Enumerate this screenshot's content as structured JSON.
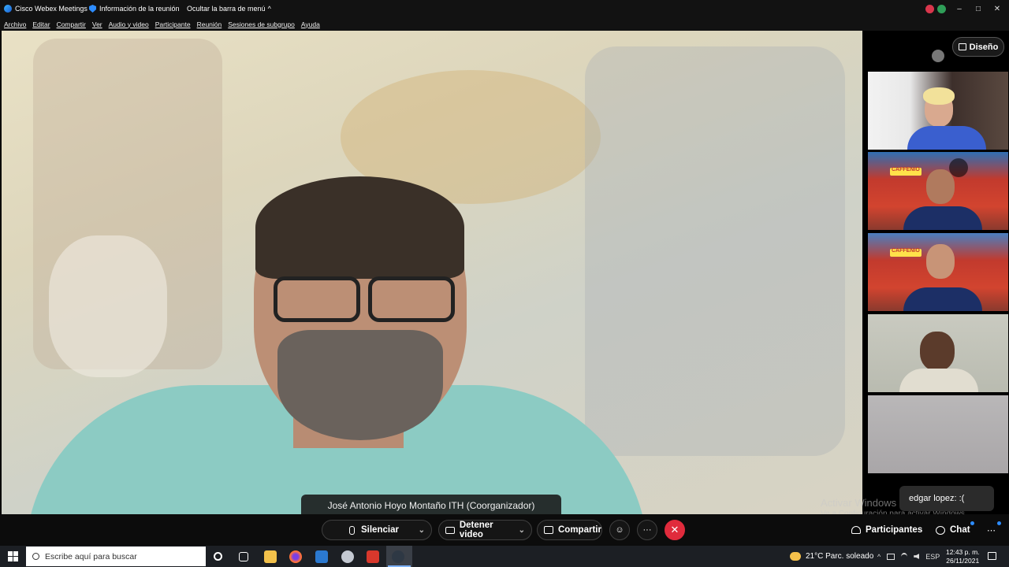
{
  "titlebar": {
    "app_name": "Cisco Webex Meetings",
    "meeting_info": "Información de la reunión",
    "hide_menu": "Ocultar la barra de menú",
    "hide_chevron": "^",
    "minimize": "–",
    "maximize": "□",
    "close": "✕"
  },
  "menu": {
    "items": [
      "Archivo",
      "Editar",
      "Compartir",
      "Ver",
      "Audio y video",
      "Participante",
      "Reunión",
      "Sesiones de subgrupo",
      "Ayuda"
    ]
  },
  "main": {
    "speaker_name": "José Antonio Hoyo Montaño ITH (Coorganizador)"
  },
  "side": {
    "layout_button": "Diseño",
    "badge_text_2": "CAFFENIO",
    "badge_text_3": "CAFFENIO"
  },
  "watermark": {
    "line1": "Activar Windows",
    "line2": "Ve a Configuración para activar Windows."
  },
  "toast": {
    "message": "edgar lopez: :("
  },
  "controls": {
    "mute": "Silenciar",
    "stop_video": "Detener video",
    "share": "Compartir",
    "more": "···",
    "end": "✕",
    "reaction": "☺",
    "participants": "Participantes",
    "chat": "Chat",
    "chevron": "⌄",
    "more_right": "⋯"
  },
  "taskbar": {
    "search_placeholder": "Escribe aquí para buscar",
    "weather": "21°C  Parc. soleado",
    "language": "ESP",
    "time": "12:43 p. m.",
    "date": "26/11/2021",
    "tray_chevron": "^"
  },
  "colors": {
    "accent": "#2d8cff",
    "end_call": "#e02b3c",
    "background": "#000000"
  }
}
